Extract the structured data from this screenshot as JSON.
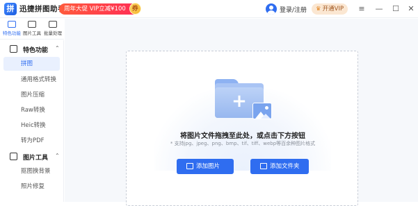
{
  "app": {
    "title": "迅捷拼图助手",
    "logo_glyph": "拼",
    "promo_text": "周年大促 VIP立减¥100",
    "promo_badge": "券",
    "login_text": "登录/注册",
    "vip_label": "开通VIP",
    "colors": {
      "accent": "#2f6df0",
      "promo": "#ff2d55",
      "vip_bg": "#fbe7d2"
    }
  },
  "window_controls": [
    {
      "name": "menu-icon",
      "glyph": "≡"
    },
    {
      "name": "minimize-icon",
      "glyph": "—"
    },
    {
      "name": "maximize-icon",
      "glyph": "☐"
    },
    {
      "name": "close-icon",
      "glyph": "✕"
    }
  ],
  "icon_tabs": [
    {
      "label": "特色功能",
      "active": true
    },
    {
      "label": "图片工具",
      "active": false
    },
    {
      "label": "批量处理",
      "active": false
    }
  ],
  "sidebar": {
    "groups": [
      {
        "label": "特色功能",
        "icon": "grid-icon",
        "chevron": "⌃",
        "items": [
          "拼图",
          "通用格式转换",
          "图片压缩",
          "Raw转换",
          "Heic转换",
          "转为PDF"
        ]
      },
      {
        "label": "图片工具",
        "icon": "image-tool-icon",
        "chevron": "⌃",
        "items": [
          "抠图换背景",
          "照片修复"
        ]
      }
    ],
    "active_item": "拼图"
  },
  "dropzone": {
    "title": "将图片文件拖拽至此处，或点击下方按钮",
    "hint": "* 支持jpg、jpeg、png、bmp、tif、tiff、webp等百余种图片格式",
    "plus_glyph": "+",
    "add_images_label": "添加图片",
    "add_folder_label": "添加文件夹"
  }
}
